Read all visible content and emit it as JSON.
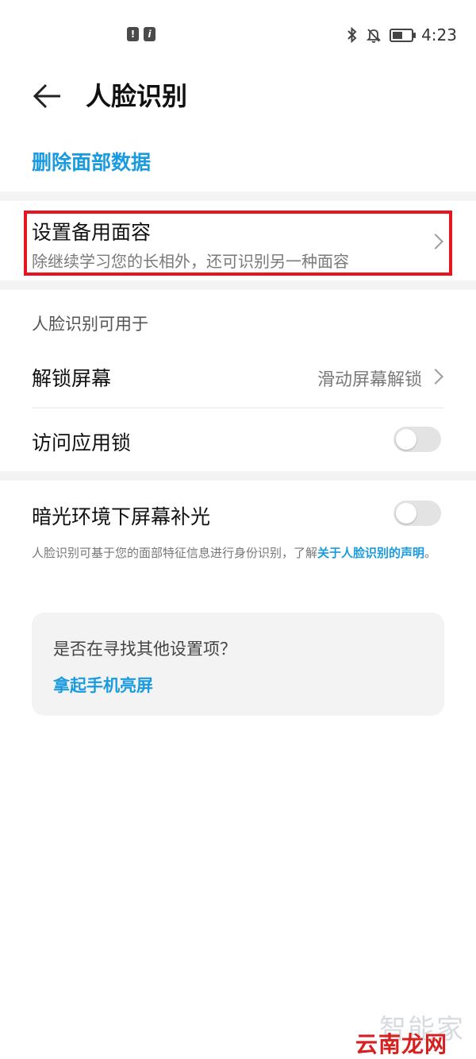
{
  "status_bar": {
    "time": "4:23",
    "left_icons": [
      "sim-alert-icon",
      "info-icon"
    ],
    "right_icons": [
      "bluetooth-icon",
      "bell-off-icon",
      "battery-icon"
    ],
    "battery_level": 0.55
  },
  "header": {
    "title": "人脸识别"
  },
  "delete_face_data": "删除面部数据",
  "alternate_face": {
    "title": "设置备用面容",
    "subtitle": "除继续学习您的长相外，还可识别另一种面容"
  },
  "usage_section": {
    "label": "人脸识别可用于",
    "unlock_screen": {
      "title": "解锁屏幕",
      "value": "滑动屏幕解锁"
    },
    "app_lock": {
      "title": "访问应用锁",
      "enabled": false
    }
  },
  "low_light": {
    "title": "暗光环境下屏幕补光",
    "enabled": false
  },
  "note": {
    "text": "人脸识别可基于您的面部特征信息进行身份识别，了解",
    "link": "关于人脸识别的声明",
    "suffix": "。"
  },
  "suggestion_card": {
    "question": "是否在寻找其他设置项？",
    "link": "拿起手机亮屏"
  },
  "watermark": {
    "line1": "智能家",
    "line2": "云南龙网"
  },
  "colors": {
    "accent": "#1a9be0",
    "highlight": "#e8141f",
    "section_gap": "#f3f3f3"
  }
}
